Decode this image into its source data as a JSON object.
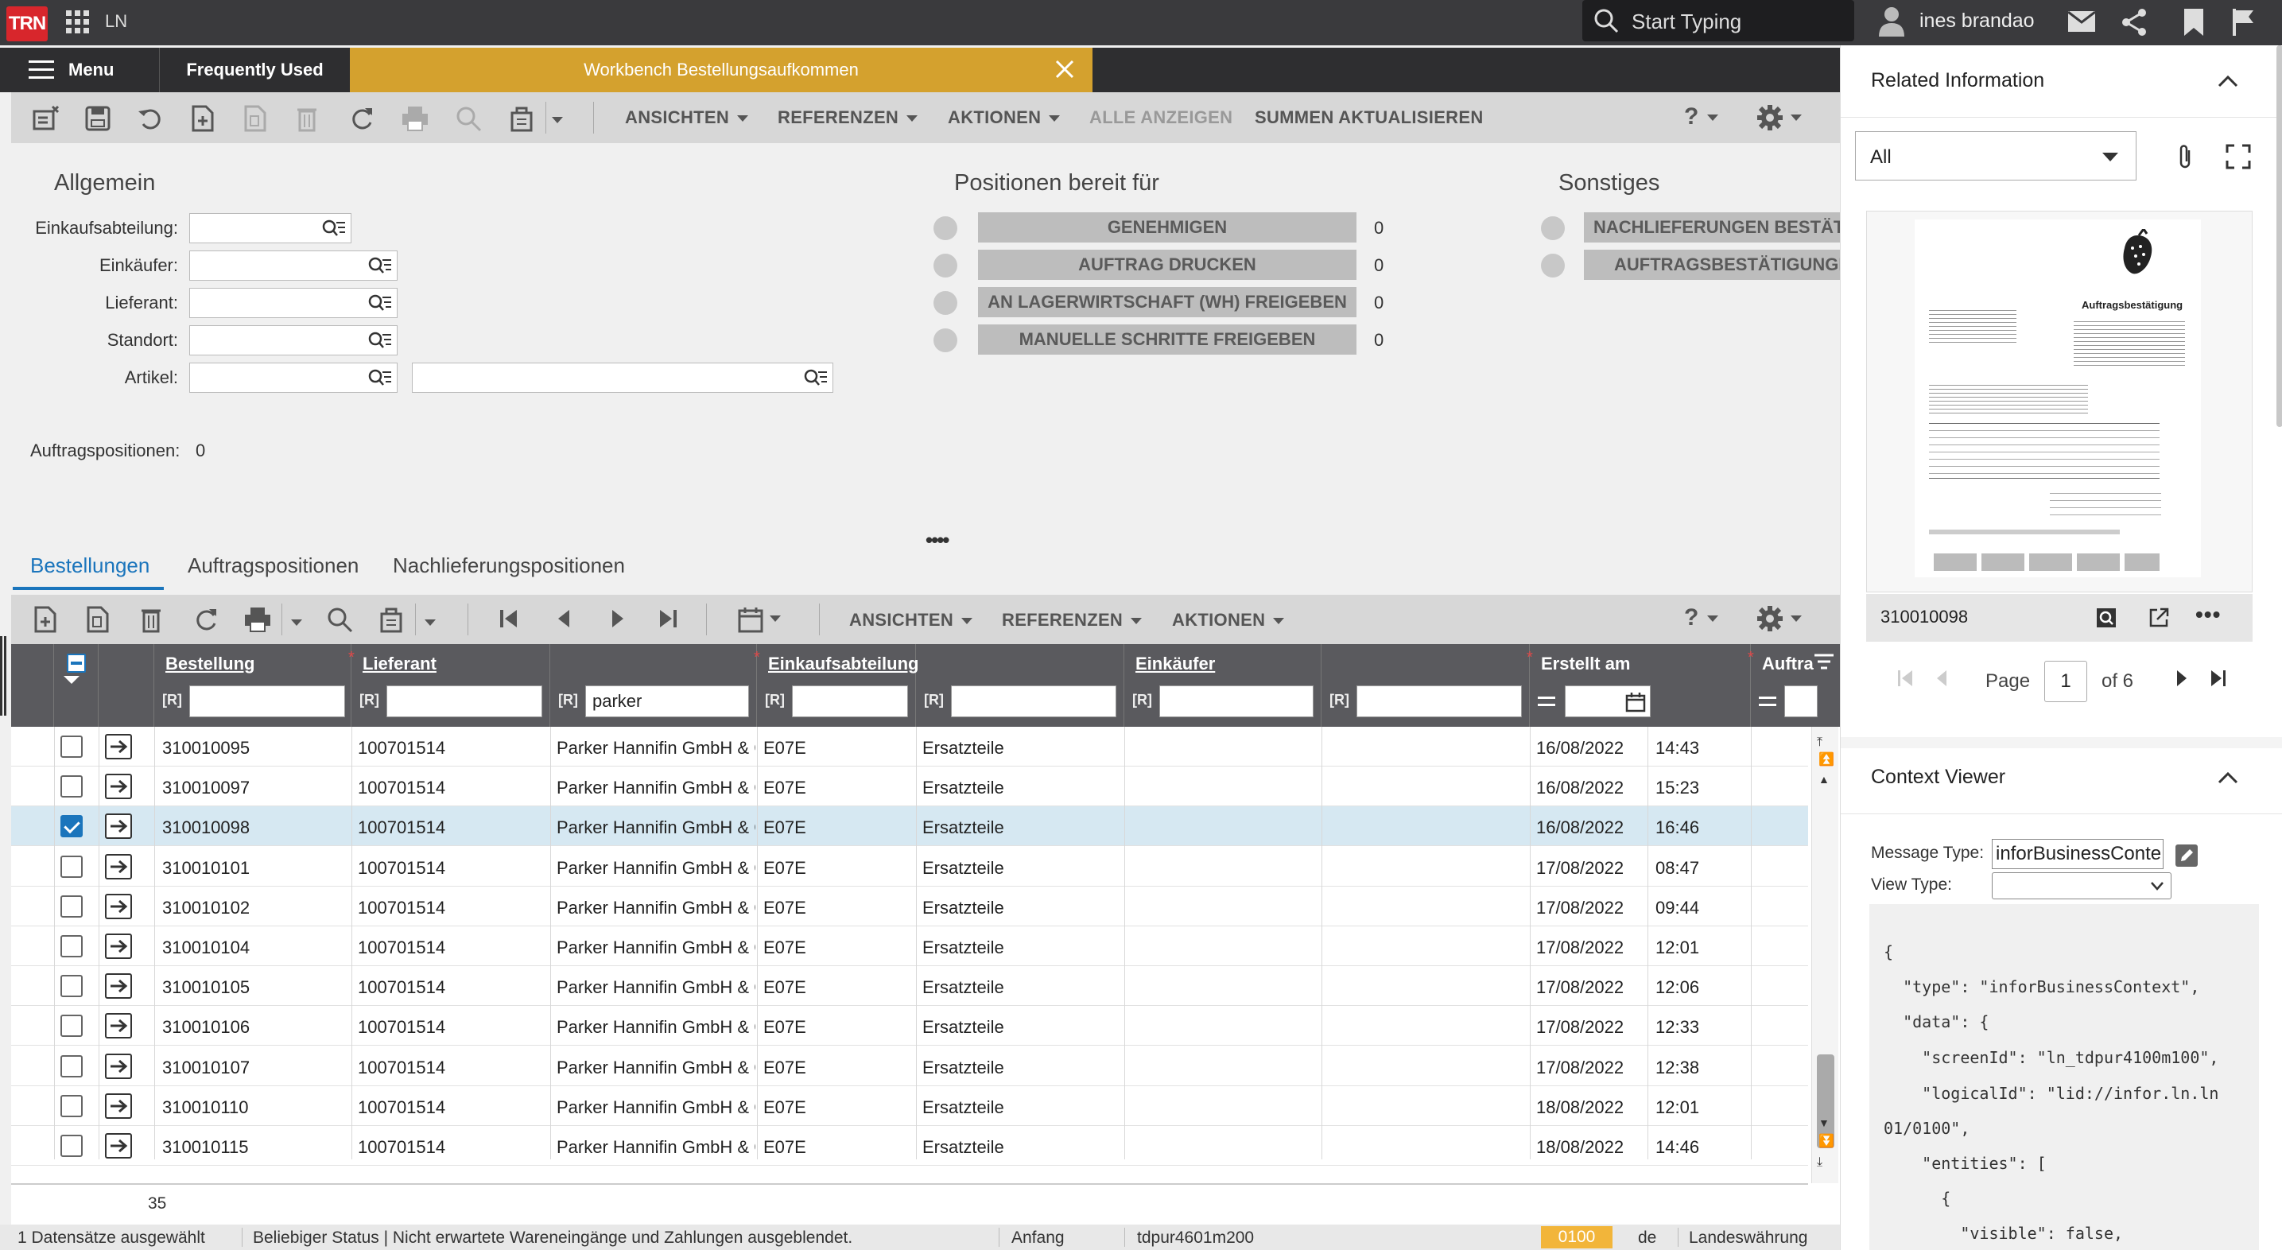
{
  "topbar": {
    "logo": "TRN",
    "app": "LN",
    "search_placeholder": "Start Typing",
    "user": "ines brandao"
  },
  "tabs": {
    "menu": "Menu",
    "frequently_used": "Frequently Used",
    "active": "Workbench Bestellungsaufkommen"
  },
  "toolbar": {
    "views": "ANSICHTEN",
    "references": "REFERENZEN",
    "actions": "AKTIONEN",
    "show_all": "ALLE ANZEIGEN",
    "update_totals": "SUMMEN AKTUALISIEREN",
    "help": "?"
  },
  "general": {
    "title": "Allgemein",
    "fields": [
      {
        "label": "Einkaufsabteilung:",
        "value": ""
      },
      {
        "label": "Einkäufer:",
        "value": ""
      },
      {
        "label": "Lieferant:",
        "value": ""
      },
      {
        "label": "Standort:",
        "value": ""
      },
      {
        "label": "Artikel:",
        "value": ""
      }
    ],
    "order_positions_label": "Auftragspositionen:",
    "order_positions_value": "0"
  },
  "ready": {
    "title": "Positionen bereit für",
    "items": [
      {
        "label": "GENEHMIGEN",
        "count": "0"
      },
      {
        "label": "AUFTRAG DRUCKEN",
        "count": "0"
      },
      {
        "label": "AN LAGERWIRTSCHAFT (WH) FREIGEBEN",
        "count": "0"
      },
      {
        "label": "MANUELLE SCHRITTE FREIGEBEN",
        "count": "0"
      }
    ]
  },
  "misc": {
    "title": "Sonstiges",
    "items": [
      {
        "label": "NACHLIEFERUNGEN BESTÄTI"
      },
      {
        "label": "AUFTRAGSBESTÄTIGUNGE"
      }
    ]
  },
  "lower_tabs": [
    "Bestellungen",
    "Auftragspositionen",
    "Nachlieferungspositionen"
  ],
  "toolbar2": {
    "views": "ANSICHTEN",
    "references": "REFERENZEN",
    "actions": "AKTIONEN",
    "help": "?"
  },
  "grid": {
    "columns": {
      "order": "Bestellung",
      "supplier": "Lieferant",
      "dept": "Einkaufsabteilung",
      "buyer": "Einkäufer",
      "created": "Erstellt am",
      "order_short": "Auftra"
    },
    "filter_tag": "[R]",
    "filter_supplier_name": "parker",
    "rows": [
      {
        "order": "310010095",
        "supplier": "100701514",
        "name": "Parker Hannifin GmbH & C",
        "dept": "E07E",
        "dept_name": "Ersatzteile",
        "date": "16/08/2022",
        "time": "14:43",
        "selected": false
      },
      {
        "order": "310010097",
        "supplier": "100701514",
        "name": "Parker Hannifin GmbH & C",
        "dept": "E07E",
        "dept_name": "Ersatzteile",
        "date": "16/08/2022",
        "time": "15:23",
        "selected": false
      },
      {
        "order": "310010098",
        "supplier": "100701514",
        "name": "Parker Hannifin GmbH & C",
        "dept": "E07E",
        "dept_name": "Ersatzteile",
        "date": "16/08/2022",
        "time": "16:46",
        "selected": true
      },
      {
        "order": "310010101",
        "supplier": "100701514",
        "name": "Parker Hannifin GmbH & C",
        "dept": "E07E",
        "dept_name": "Ersatzteile",
        "date": "17/08/2022",
        "time": "08:47",
        "selected": false
      },
      {
        "order": "310010102",
        "supplier": "100701514",
        "name": "Parker Hannifin GmbH & C",
        "dept": "E07E",
        "dept_name": "Ersatzteile",
        "date": "17/08/2022",
        "time": "09:44",
        "selected": false
      },
      {
        "order": "310010104",
        "supplier": "100701514",
        "name": "Parker Hannifin GmbH & C",
        "dept": "E07E",
        "dept_name": "Ersatzteile",
        "date": "17/08/2022",
        "time": "12:01",
        "selected": false
      },
      {
        "order": "310010105",
        "supplier": "100701514",
        "name": "Parker Hannifin GmbH & C",
        "dept": "E07E",
        "dept_name": "Ersatzteile",
        "date": "17/08/2022",
        "time": "12:06",
        "selected": false
      },
      {
        "order": "310010106",
        "supplier": "100701514",
        "name": "Parker Hannifin GmbH & C",
        "dept": "E07E",
        "dept_name": "Ersatzteile",
        "date": "17/08/2022",
        "time": "12:33",
        "selected": false
      },
      {
        "order": "310010107",
        "supplier": "100701514",
        "name": "Parker Hannifin GmbH & C",
        "dept": "E07E",
        "dept_name": "Ersatzteile",
        "date": "17/08/2022",
        "time": "12:38",
        "selected": false
      },
      {
        "order": "310010110",
        "supplier": "100701514",
        "name": "Parker Hannifin GmbH & C",
        "dept": "E07E",
        "dept_name": "Ersatzteile",
        "date": "18/08/2022",
        "time": "12:01",
        "selected": false
      },
      {
        "order": "310010115",
        "supplier": "100701514",
        "name": "Parker Hannifin GmbH & C",
        "dept": "E07E",
        "dept_name": "Ersatzteile",
        "date": "18/08/2022",
        "time": "14:46",
        "selected": false
      }
    ],
    "total_count": "35"
  },
  "status": {
    "selected": "1 Datensätze ausgewählt",
    "message": "Beliebiger Status | Nicht erwartete Wareneingänge und Zahlungen ausgeblendet.",
    "position": "Anfang",
    "session": "tdpur4601m200",
    "company": "0100",
    "lang": "de",
    "currency": "Landeswährung"
  },
  "related": {
    "title": "Related Information",
    "filter": "All",
    "doc_id": "310010098",
    "doc_title": "Auftragsbestätigung",
    "page_label": "Page",
    "page_current": "1",
    "page_of": "of 6"
  },
  "context": {
    "title": "Context Viewer",
    "message_type_label": "Message Type:",
    "message_type_value": "inforBusinessConte",
    "view_type_label": "View Type:",
    "view_type_value": "",
    "code": [
      "{",
      "  \"type\": \"inforBusinessContext\",",
      "  \"data\": {",
      "    \"screenId\": \"ln_tdpur4100m100\",",
      "    \"logicalId\": \"lid://infor.ln.ln",
      "01/0100\",",
      "    \"entities\": [",
      "      {",
      "        \"visible\": false,"
    ]
  },
  "colors": {
    "topbar": "#3a3a3d",
    "active_tab": "#d4a12e",
    "accent": "#1b75bc",
    "company_badge": "#f2b53a"
  }
}
